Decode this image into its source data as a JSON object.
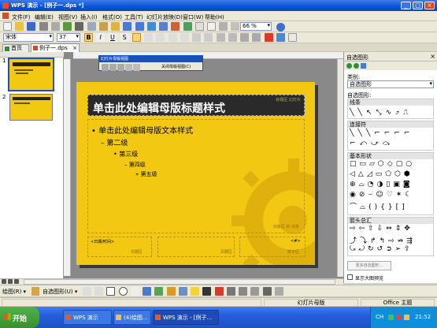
{
  "window": {
    "title": "WPS 演示 - [例子一.dps *]",
    "controls": [
      "_",
      "□",
      "×"
    ]
  },
  "menubar": {
    "items": [
      "文件(F)",
      "编辑(E)",
      "视图(V)",
      "插入(I)",
      "格式(O)",
      "工具(T)",
      "幻灯片放映(D)",
      "窗口(W)",
      "帮助(H)"
    ]
  },
  "toolbar": {
    "zoom": "66 %"
  },
  "format_toolbar": {
    "font_name": "宋体",
    "font_size": "37"
  },
  "tabs": [
    {
      "label": "首页"
    },
    {
      "label": "例子一.dps"
    }
  ],
  "thumbs": [
    {
      "num": "1"
    },
    {
      "num": "2"
    }
  ],
  "master_toolbar": {
    "title": "幻灯片母版视图",
    "close_label": "关闭母版视图(C)"
  },
  "slide": {
    "title": "单击此处编辑母版标题样式",
    "title_tag": "标题区 幻灯片",
    "bullets": [
      {
        "level": 1,
        "text": "单击此处编辑母版文本样式"
      },
      {
        "level": 2,
        "text": "第二级"
      },
      {
        "level": 3,
        "text": "第三级"
      },
      {
        "level": 4,
        "text": "第四级"
      },
      {
        "level": 5,
        "text": "第五级"
      }
    ],
    "object_tag": "对象区 的 对象",
    "footer": {
      "date_label": "日期区",
      "footer_label": "页脚区",
      "number_label": "数字区",
      "date_field": "<日期/时间>",
      "number_field": "<#>"
    }
  },
  "right_panel": {
    "title": "自选图形",
    "category_label": "类别:",
    "category_value": "自选图形",
    "shapes_label": "自选图形:",
    "sections": [
      {
        "label": "线条"
      },
      {
        "label": "连接符"
      },
      {
        "label": "基本形状"
      },
      {
        "label": "箭头总汇"
      }
    ],
    "more_button": "更多自选图形...",
    "checkbox_label": "显示大图预览"
  },
  "draw_toolbar": {
    "draw_label": "绘图(R)",
    "autoshapes_label": "自选图形(U)"
  },
  "statusbar": {
    "cell1": "幻灯片母版",
    "cell2": "Office 主题"
  },
  "taskbar": {
    "start": "开始",
    "tasks": [
      {
        "label": "WPS 演示"
      },
      {
        "label": "(4)绘图..."
      },
      {
        "label": "WPS 演示 - [例子..."
      }
    ],
    "lang": "CH",
    "clock": "21:52"
  },
  "colors": {
    "slide_yellow": "#f2c812",
    "title_bar": "#2a2a2a",
    "taskbar_blue": "#245edb",
    "titlebar_blue": "#0a52d8",
    "start_green": "#3c8f2e"
  }
}
